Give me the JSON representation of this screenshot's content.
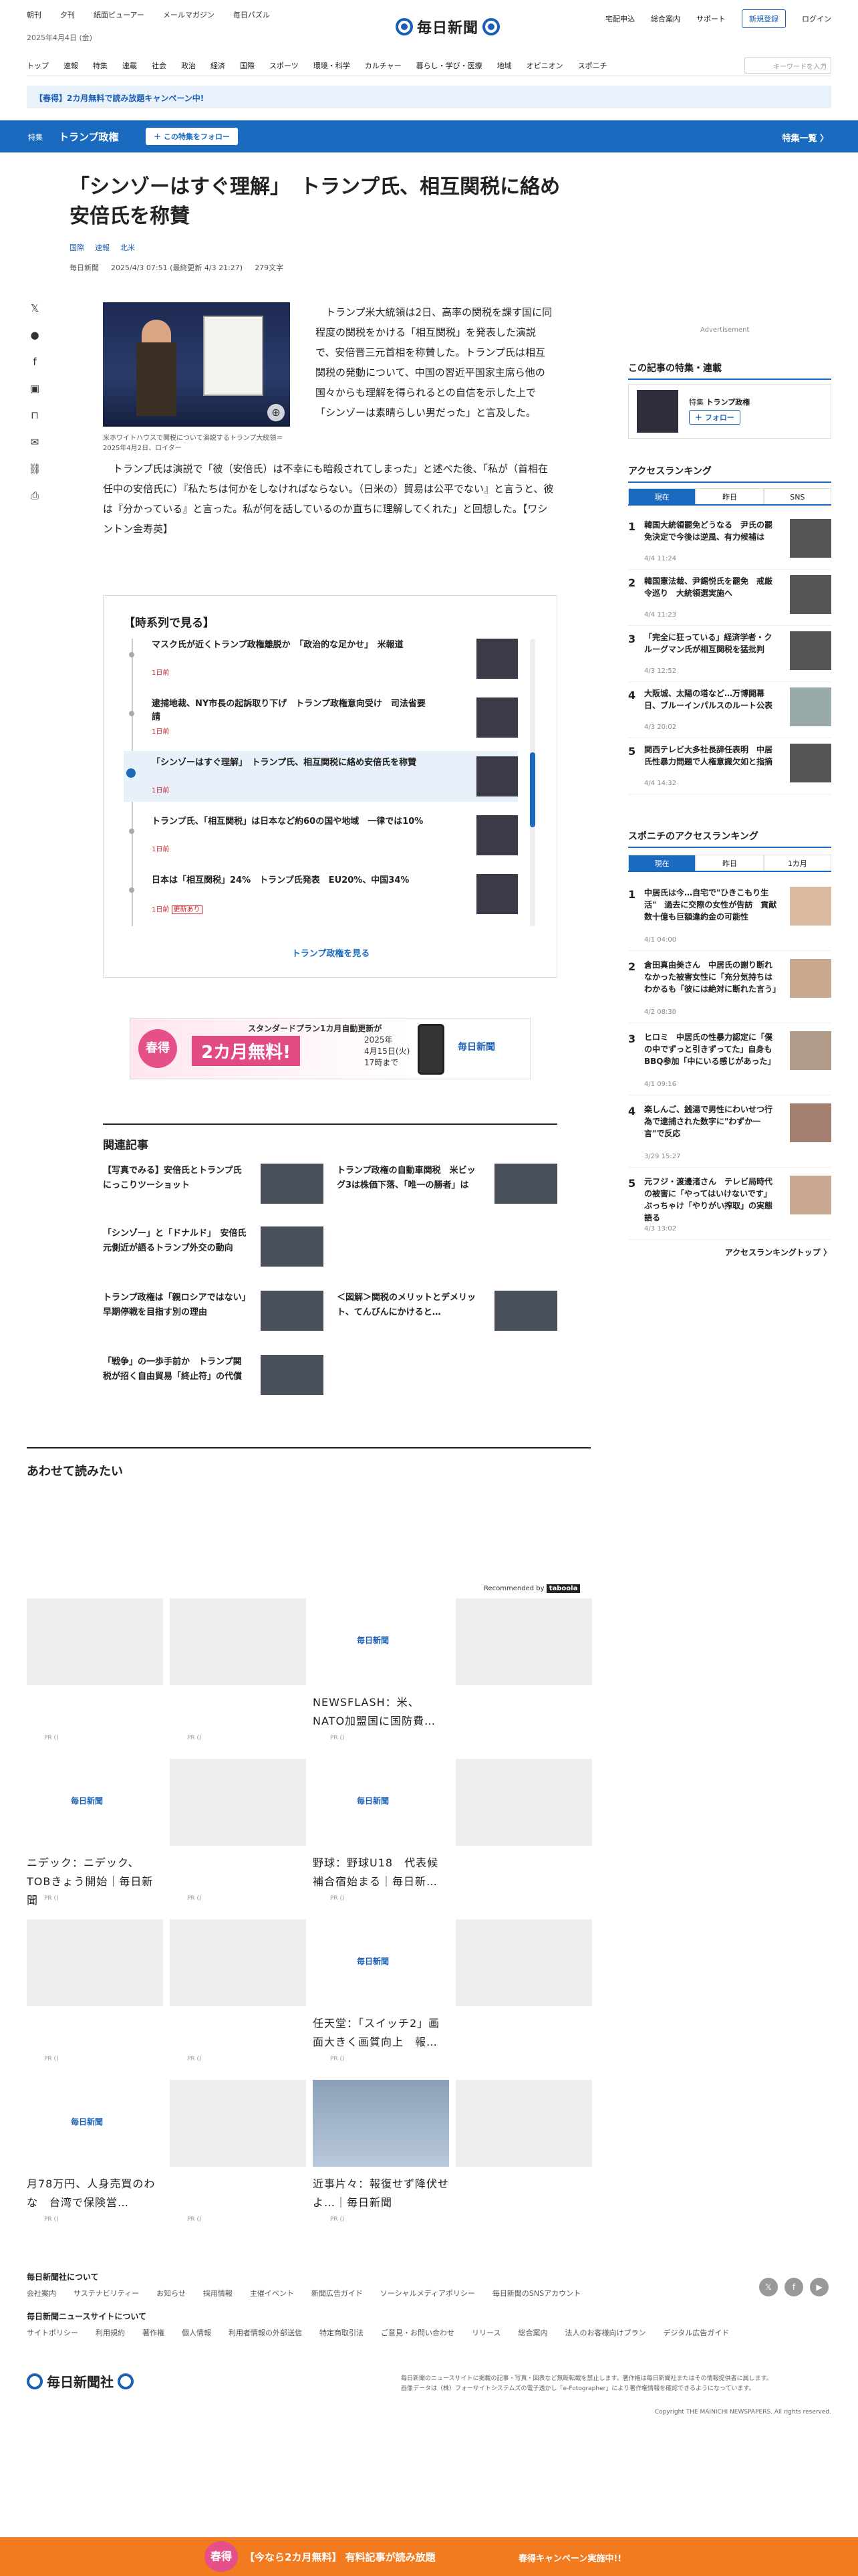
{
  "header": {
    "links": [
      "朝刊",
      "夕刊",
      "紙面ビューアー",
      "メールマガジン",
      "毎日パズル"
    ],
    "date": "2025年4月4日 (金)",
    "logo": "毎日新聞",
    "right_links": [
      "宅配申込",
      "総合案内",
      "サポート"
    ],
    "register": "新規登録",
    "login": "ログイン"
  },
  "nav": {
    "items": [
      "トップ",
      "速報",
      "特集",
      "連載",
      "社会",
      "政治",
      "経済",
      "国際",
      "スポーツ",
      "環境・科学",
      "カルチャー",
      "暮らし・学び・医療",
      "地域",
      "オピニオン",
      "スポニチ"
    ],
    "search_placeholder": "キーワードを入力"
  },
  "campaign": "【春得】2カ月無料で読み放題キャンペーン中!",
  "feature": {
    "tag": "特集",
    "title": "トランプ政権",
    "follow": "＋ この特集をフォロー",
    "list": "特集一覧 〉"
  },
  "article": {
    "title": "「シンゾーはすぐ理解」　トランプ氏、相互関税に絡め安倍氏を称賛",
    "cats": [
      "国際",
      "速報",
      "北米"
    ],
    "source": "毎日新聞",
    "date": "2025/4/3 07:51 (最終更新 4/3 21:27)",
    "chars": "279文字",
    "caption": "米ホワイトハウスで関税について演説するトランプ大統領＝2025年4月2日、ロイター",
    "p1": "トランプ米大統領は2日、高率の関税を課す国に同程度の関税をかける「相互関税」を発表した演説で、安倍晋三元首相を称賛した。トランプ氏は相互関税の発動について、中国の習近平国家主席ら他の国々からも理解を得られるとの自信を示した上で「シンゾーは素晴らしい男だった」と言及した。",
    "p2": "トランプ氏は演説で「彼（安倍氏）は不幸にも暗殺されてしまった」と述べた後、「私が（首相在任中の安倍氏に）『私たちは何かをしなければならない。（日米の）貿易は公平でない』と言うと、彼は『分かっている』と言った。私が何を話しているのか直ちに理解してくれた」と回想した。【ワシントン金寿英】"
  },
  "timeline": {
    "title": "【時系列で見る】",
    "items": [
      {
        "h": "マスク氏が近くトランプ政権離脱か　「政治的な足かせ」　米報道",
        "d": "1日前"
      },
      {
        "h": "逮捕地裁、NY市長の起訴取り下げ　トランプ政権意向受け　司法省要請",
        "d": "1日前"
      },
      {
        "h": "「シンゾーはすぐ理解」　トランプ氏、相互関税に絡め安倍氏を称賛",
        "d": "1日前"
      },
      {
        "h": "トランプ氏、「相互関税」は日本など約60の国や地域　一律では10%",
        "d": "1日前"
      },
      {
        "h": "日本は「相互関税」24%　トランプ氏発表　EU20%、中国34%",
        "d": "1日前",
        "badge": "更新あり"
      }
    ],
    "more": "トランプ政権を見る"
  },
  "banner": {
    "heart": "春得",
    "top": "スタンダードプラン1カ月自動更新が",
    "main": "2カ月無料!",
    "date": "2025年\n4月15日(火)\n17時まで",
    "logo": "毎日新聞"
  },
  "related": {
    "title": "関連記事",
    "items": [
      "【写真でみる】安倍氏とトランプ氏　にっこりツーショット",
      "トランプ政権の自動車関税　米ビッグ3は株価下落、「唯一の勝者」は",
      "「シンゾー」と「ドナルド」　安倍氏元側近が語るトランプ外交の動向",
      "トランプ政権は「親ロシアではない」　早期停戦を目指す別の理由",
      "＜図解＞関税のメリットとデメリット、てんびんにかけると…",
      "「戦争」の一歩手前か　トランプ関税が招く自由貿易「終止符」の代償"
    ]
  },
  "sidebar": {
    "adv": "Advertisement",
    "feature_h": "この記事の特集・連載",
    "feature_tag": "特集",
    "feature_name": "トランプ政権",
    "feature_follow": "＋ フォロー",
    "rank_h": "アクセスランキング",
    "rank_tabs": [
      "現在",
      "昨日",
      "SNS"
    ],
    "rank": [
      {
        "t": "韓国大統領罷免どうなる　尹氏の罷免決定で今後は逆風、有力候補は",
        "d": "4/4 11:24"
      },
      {
        "t": "韓国憲法裁、尹錫悦氏を罷免　戒厳令巡り　大統領選実施へ",
        "d": "4/4 11:23"
      },
      {
        "t": "「完全に狂っている」経済学者・クルーグマン氏が相互関税を猛批判",
        "d": "4/3 12:52"
      },
      {
        "t": "大阪城、太陽の塔など…万博開幕日、ブルーインパルスのルート公表",
        "d": "4/3 20:02"
      },
      {
        "t": "関西テレビ大多社長辞任表明　中居氏性暴力問題で人権意識欠如と指摘",
        "d": "4/4 14:32"
      }
    ],
    "spo_h": "スポニチのアクセスランキング",
    "spo_tabs": [
      "現在",
      "昨日",
      "1カ月"
    ],
    "spo": [
      {
        "t": "中居氏は今…自宅で\"ひきこもり生活\"　過去に交際の女性が告訪　貢献数十億も巨額違約金の可能性",
        "d": "4/1 04:00"
      },
      {
        "t": "倉田真由美さん　中居氏の謝り断れなかった被害女性に「充分気持ちはわかるも「彼には絶対に断れた言う」",
        "d": "4/2 08:30"
      },
      {
        "t": "ヒロミ　中居氏の性暴力認定に「僕の中でずっと引きずってた」自身もBBQ参加「中にいる感じがあった」",
        "d": "4/1 09:16"
      },
      {
        "t": "楽しんご、銭湯で男性にわいせつ行為で逮捕された数字に\"わずか一言\"で反応",
        "d": "3/29 15:27"
      },
      {
        "t": "元フジ・渡邊渚さん　テレビ局時代の被害に「やってはいけないです」ぶっちゃけ「やりがい搾取」の実態語る",
        "d": "4/3 13:02"
      }
    ],
    "spo_more": "アクセスランキングトップ 〉"
  },
  "awase": "あわせて読みたい",
  "reco": "Recommended by",
  "reco_brand": "taboola",
  "cards": [
    {
      "txt": "",
      "pr": "PR ()"
    },
    {
      "txt": "",
      "pr": "PR ()"
    },
    {
      "txt": "NEWSFLASH：米、NATO加盟国に国防費…",
      "pr": "PR ()"
    },
    {
      "txt": "",
      "pr": ""
    },
    {
      "txt": "ニデック：ニデック、TOBきょう開始｜毎日新聞",
      "pr": "PR ()"
    },
    {
      "txt": "",
      "pr": "PR ()"
    },
    {
      "txt": "野球：野球U18　代表候補合宿始まる｜毎日新…",
      "pr": "PR ()"
    },
    {
      "txt": "",
      "pr": ""
    },
    {
      "txt": "",
      "pr": "PR ()"
    },
    {
      "txt": "",
      "pr": "PR ()"
    },
    {
      "txt": "任天堂：「スイッチ2」画面大きく画質向上　報…",
      "pr": "PR ()"
    },
    {
      "txt": "",
      "pr": ""
    },
    {
      "txt": "月78万円、人身売買のわな　台湾で保険営…",
      "pr": "PR ()"
    },
    {
      "txt": "",
      "pr": "PR ()"
    },
    {
      "txt": "近事片々：報復せず降伏せよ…｜毎日新聞",
      "pr": "PR ()"
    },
    {
      "txt": "",
      "pr": ""
    }
  ],
  "footer": {
    "h1": "毎日新聞社について",
    "l1": [
      "会社案内",
      "サステナビリティー",
      "お知らせ",
      "採用情報",
      "主催イベント",
      "新聞広告ガイド",
      "ソーシャルメディアポリシー",
      "毎日新聞のSNSアカウント"
    ],
    "h2": "毎日新聞ニュースサイトについて",
    "l2": [
      "サイトポリシー",
      "利用規約",
      "著作権",
      "個人情報",
      "利用者情報の外部送信",
      "特定商取引法",
      "ご意見・お問い合わせ",
      "リリース",
      "総合案内",
      "法人のお客様向けプラン",
      "デジタル広告ガイド"
    ],
    "logo": "毎日新聞社",
    "note": "毎日新聞のニュースサイトに掲載の記事・写真・図表など無断転載を禁止します。著作権は毎日新聞社またはその情報提供者に属します。\n画像データは（株）フォーサイトシステムズの電子透かし「e-Fotographer」により著作権情報を確認できるようになっています。",
    "copy": "Copyright THE MAINICHI NEWSPAPERS. All rights reserved."
  },
  "bottom": {
    "heart": "春得",
    "text": "【今なら2カ月無料】 有料記事が読み放題",
    "cta": "春得キャンペーン実施中!!"
  }
}
